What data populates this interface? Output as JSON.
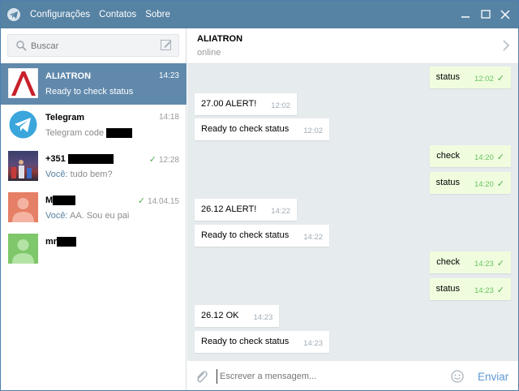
{
  "menu": [
    "Configurações",
    "Contatos",
    "Sobre"
  ],
  "search": {
    "placeholder": "Buscar"
  },
  "dialogs": [
    {
      "name": "ALIATRON",
      "time": "14:23",
      "preview": "Ready to check status",
      "active": true,
      "avatar": "aliatron-logo"
    },
    {
      "name": "Telegram",
      "time": "14:18",
      "preview": "Telegram code",
      "avatar": "telegram-logo"
    },
    {
      "name": "+351",
      "time": "12:28",
      "you": "Você:",
      "preview": "tudo bem?",
      "avatar": "photo"
    },
    {
      "name": "M",
      "time": "14.04.15",
      "you": "Você:",
      "preview": "AA. Sou eu pai",
      "avatar": "orange-user"
    },
    {
      "name": "mr",
      "time": "",
      "preview": "",
      "avatar": "green-user"
    }
  ],
  "chat": {
    "name": "ALIATRON",
    "status": "online"
  },
  "messages": [
    {
      "dir": "out",
      "text": "status",
      "time": "12:02"
    },
    {
      "dir": "in",
      "text": "27.00 ALERT!",
      "time": "12:02"
    },
    {
      "dir": "in",
      "text": "Ready to check status",
      "time": "12:02"
    },
    {
      "dir": "out",
      "text": "check",
      "time": "14:20"
    },
    {
      "dir": "out",
      "text": "status",
      "time": "14:20"
    },
    {
      "dir": "in",
      "text": "26.12 ALERT!",
      "time": "14:22"
    },
    {
      "dir": "in",
      "text": "Ready to check status",
      "time": "14:22"
    },
    {
      "dir": "out",
      "text": "check",
      "time": "14:23"
    },
    {
      "dir": "out",
      "text": "status",
      "time": "14:23"
    },
    {
      "dir": "in",
      "text": "26.12 OK",
      "time": "14:23"
    },
    {
      "dir": "in",
      "text": "Ready to check status",
      "time": "14:23"
    }
  ],
  "composer": {
    "placeholder": "Escrever a mensagem...",
    "send_label": "Enviar"
  },
  "colors": {
    "titlebar": "#5682a3",
    "active_dialog": "#6089ac",
    "outgoing_bubble": "#effdde",
    "chat_bg": "#e6ebee"
  }
}
